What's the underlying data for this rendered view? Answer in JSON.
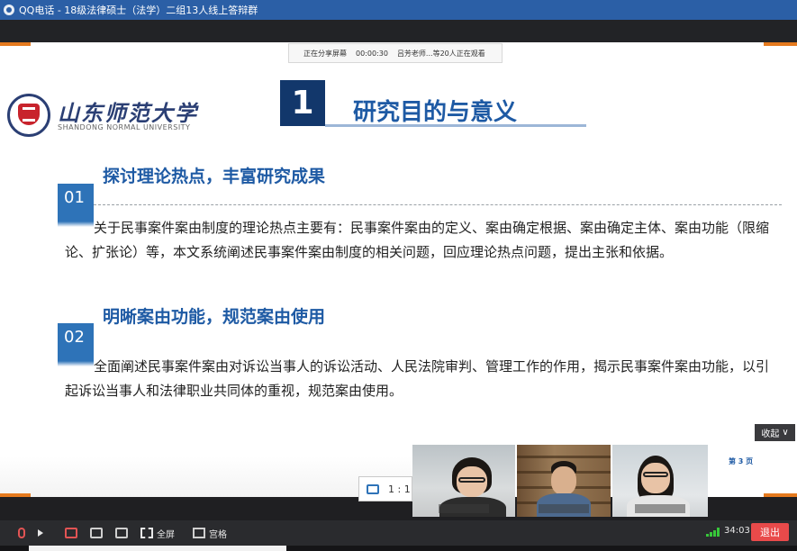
{
  "window": {
    "title": "QQ电话 - 18级法律硕士（法学）二组13人线上答辩群"
  },
  "share_bar": {
    "status": "正在分享屏幕",
    "time": "00:00:30",
    "viewers": "吕芳老师...等20人正在观看"
  },
  "slide": {
    "logo_cn": "山东师范大学",
    "logo_en": "SHANDONG NORMAL UNIVERSITY",
    "section_number": "1",
    "heading": "研究目的与意义",
    "sections": [
      {
        "num": "01",
        "title": "探讨理论热点，丰富研究成果",
        "text": "关于民事案件案由制度的理论热点主要有：民事案件案由的定义、案由确定根据、案由确定主体、案由功能（限缩论、扩张论）等，本文系统阐述民事案件案由制度的相关问题，回应理论热点问题，提出主张和依据。"
      },
      {
        "num": "02",
        "title": "明晰案由功能，规范案由使用",
        "text": "全面阐述民事案件案由对诉讼当事人的诉讼活动、人民法院审判、管理工作的作用，揭示民事案件案由功能，以引起诉讼当事人和法律职业共同体的重视，规范案由使用。"
      }
    ],
    "page_label": "第 3 页"
  },
  "collapse_label": "收起",
  "ratio_label": "1 : 1",
  "toolbar": {
    "fullscreen": "全屏",
    "grid": "宫格",
    "timer": "34:03",
    "exit": "退出"
  }
}
